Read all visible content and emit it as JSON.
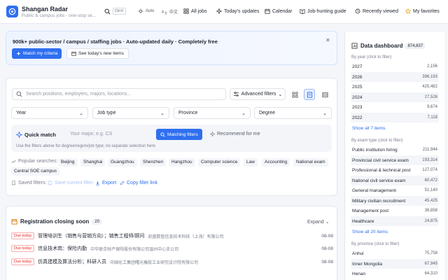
{
  "header": {
    "title": "Shangan Radar",
    "subtitle": "Public & campus jobs · one-stop se...",
    "shortcut": "Ctrl K",
    "nav": [
      {
        "label": "Auto",
        "icon": "sun-icon"
      },
      {
        "label": "中文",
        "icon": "translate-icon"
      },
      {
        "label": "All jobs",
        "icon": "grid-icon"
      },
      {
        "label": "Today's updates",
        "icon": "sparkle-icon"
      },
      {
        "label": "Calendar",
        "icon": "calendar-icon"
      },
      {
        "label": "Job-hunting guide",
        "icon": "book-icon"
      },
      {
        "label": "Recently viewed",
        "icon": "history-icon"
      },
      {
        "label": "My favorites",
        "icon": "star-icon"
      }
    ]
  },
  "banner": {
    "text": "900k+ public-sector / campus / staffing jobs · Auto-updated daily · Completely free",
    "primary_label": "Match my criteria",
    "secondary_label": "See today's new items"
  },
  "search": {
    "placeholder": "Search positions, employers, majors, locations...",
    "advanced_label": "Advanced filters",
    "filters": [
      "Year",
      "Job type",
      "Province",
      "Degree"
    ]
  },
  "quick_match": {
    "label": "Quick match",
    "placeholder": "Your major, e.g. CS",
    "match_button": "Matching filters",
    "recommend_label": "Recommend for me",
    "hint": "Use the filters above for degree/region/job type; no separate selection here"
  },
  "popular": {
    "label": "Popular searches:",
    "chips": [
      "Beijing",
      "Shanghai",
      "Guangzhou",
      "Shenzhen",
      "Hangzhou",
      "Computer science",
      "Law",
      "Accounting",
      "National exam",
      "Central SOE campus"
    ]
  },
  "saved": {
    "label": "Saved filters:",
    "save_current": "Save current filter",
    "export": "Export",
    "copy_link": "Copy filter link"
  },
  "closing": {
    "title": "Registration closing soon",
    "count": "20",
    "expand_label": "Expand",
    "rows": [
      {
        "badge": "Due today",
        "title": "管理培训生（销售与营销方向）；销售工程师/顾问",
        "org": "凯盛数智信息技术科技（上海）有限公司",
        "date": "08-08"
      },
      {
        "badge": "Due today",
        "title": "信息技术岗：保险内勤",
        "org": "中华联合财产保险股份有限公司温州中心支公司",
        "date": "08-08"
      },
      {
        "badge": "Due today",
        "title": "仿真建模及算法分析；科研人员",
        "org": "中国化工集团曙光橡胶工业研究设计院有限公司",
        "date": "08-08"
      }
    ]
  },
  "dashboard": {
    "title": "Data dashboard",
    "total": "874,837",
    "by_year_label": "By year (click to filter)",
    "years": [
      {
        "label": "2027",
        "value": "2,156"
      },
      {
        "label": "2026",
        "value": "396,193"
      },
      {
        "label": "2025",
        "value": "425,482"
      },
      {
        "label": "2024",
        "value": "27,526"
      },
      {
        "label": "2023",
        "value": "9,674"
      },
      {
        "label": "2022",
        "value": "7,118"
      }
    ],
    "show_years": "Show all 7 items",
    "by_type_label": "By exam type (click to filter)",
    "types": [
      {
        "label": "Public institution hiring",
        "value": "211,944"
      },
      {
        "label": "Provincial civil service exam",
        "value": "193,314"
      },
      {
        "label": "Professional & technical post",
        "value": "127,074"
      },
      {
        "label": "National civil service exam",
        "value": "60,472"
      },
      {
        "label": "General management",
        "value": "51,140"
      },
      {
        "label": "Military civilian recruitment",
        "value": "45,425"
      },
      {
        "label": "Management post",
        "value": "36,858"
      },
      {
        "label": "Healthcare",
        "value": "24,875"
      }
    ],
    "show_types": "Show all 20 items",
    "by_province_label": "By province (click to filter)",
    "provinces": [
      {
        "label": "Anhui",
        "value": "75,758"
      },
      {
        "label": "Inner Mongolia",
        "value": "67,945"
      },
      {
        "label": "Henan",
        "value": "64,310"
      }
    ]
  },
  "colors": {
    "accent": "#2f6ff0",
    "danger": "#e03b3b"
  }
}
